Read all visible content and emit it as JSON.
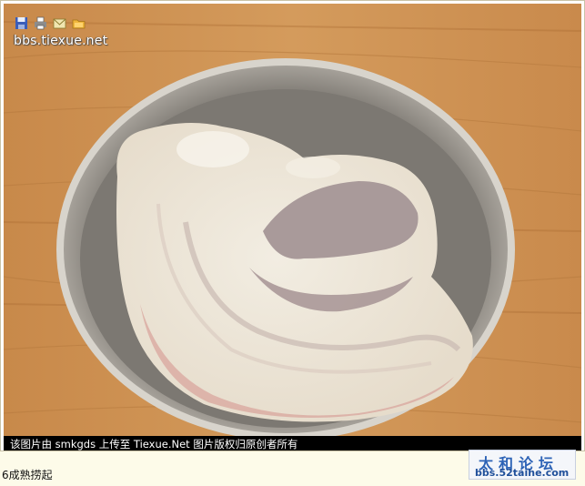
{
  "watermark": {
    "site": "bbs.tiexue.net"
  },
  "toolbar": {
    "icons": [
      "save-icon",
      "print-icon",
      "email-icon",
      "folder-icon"
    ]
  },
  "caption": {
    "text": "该图片由 smkgds 上传至 Tiexue.Net 图片版权归原创者所有"
  },
  "logo": {
    "title": "太和论坛",
    "url": "bbs.52taihe.com"
  },
  "post": {
    "text": "6成熟捞起"
  }
}
